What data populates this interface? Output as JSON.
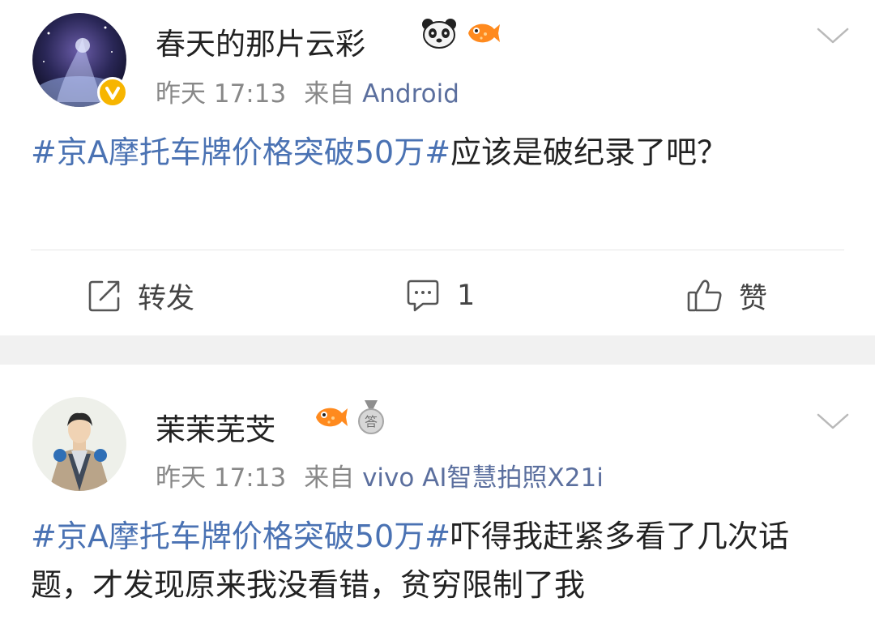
{
  "posts": [
    {
      "username": "春天的那片云彩",
      "time": "昨天 17:13",
      "from_label": "来自",
      "source": "Android",
      "topic": "#京A摩托车牌价格突破50万#",
      "text": "应该是破纪录了吧？",
      "badges": [
        "panda-icon",
        "fish-icon"
      ],
      "verified": true
    },
    {
      "username": "茉茉芜芠",
      "time": "昨天 17:13",
      "from_label": "来自",
      "source": "vivo AI智慧拍照X21i",
      "topic": "#京A摩托车牌价格突破50万#",
      "text": "吓得我赶紧多看了几次话题，才发现原来我没看错，贫穷限制了我",
      "badges": [
        "fish-icon",
        "answer-medal-icon"
      ],
      "medal_char": "答"
    }
  ],
  "actions": {
    "repost": "转发",
    "comment_count": "1",
    "like": "赞"
  },
  "colors": {
    "topic": "#4a72b3",
    "source": "#5b6f9e",
    "meta": "#888888",
    "separator": "#f1f1f1",
    "verified": "#f7b500"
  }
}
